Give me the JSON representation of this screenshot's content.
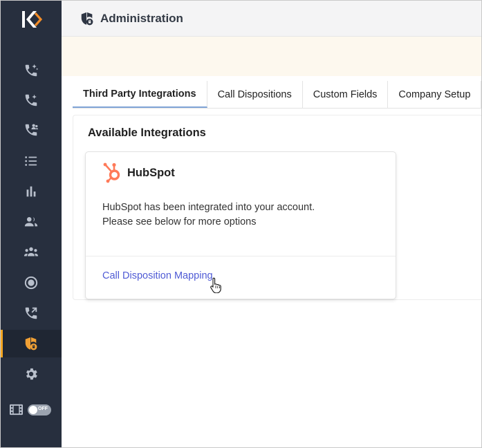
{
  "sidebar": {
    "logo_letter": "K",
    "items": [
      {
        "icon": "phone-sparkle-icon"
      },
      {
        "icon": "phone-plus-icon"
      },
      {
        "icon": "phone-users-icon"
      },
      {
        "icon": "list-icon"
      },
      {
        "icon": "bar-chart-icon"
      },
      {
        "icon": "user-group-icon"
      },
      {
        "icon": "team-icon"
      },
      {
        "icon": "record-icon"
      },
      {
        "icon": "phone-transfer-icon"
      },
      {
        "icon": "shield-lock-icon",
        "active": true
      },
      {
        "icon": "gear-icon"
      }
    ],
    "toggle_label": "OFF"
  },
  "header": {
    "title": "Administration"
  },
  "tabs": [
    {
      "label": "Third Party Integrations",
      "active": true
    },
    {
      "label": "Call Dispositions"
    },
    {
      "label": "Custom Fields"
    },
    {
      "label": "Company Setup"
    }
  ],
  "integrations": {
    "heading": "Available Integrations",
    "card": {
      "name": "HubSpot",
      "description_line1": "HubSpot has been integrated into your account.",
      "description_line2": "Please see below for more options",
      "link": "Call Disposition Mapping"
    }
  },
  "colors": {
    "sidebar_bg": "#272f3e",
    "active_accent": "#f5a623",
    "link": "#4f5bd5",
    "hubspot_orange": "#ff7a59"
  }
}
